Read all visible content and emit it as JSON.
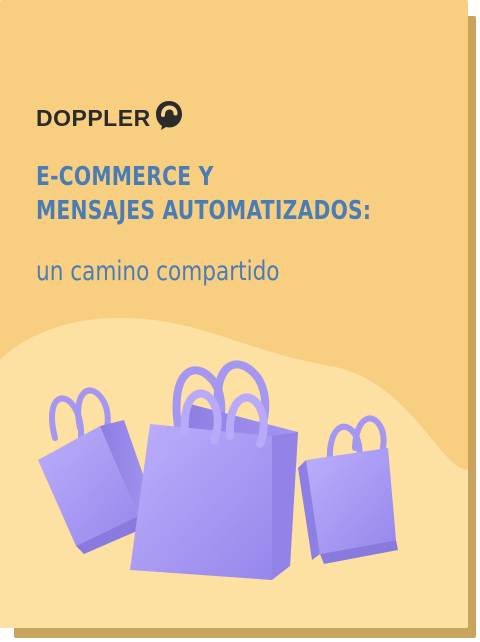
{
  "brand": {
    "name": "DOPPLER"
  },
  "cover": {
    "title_line1": "E-COMMERCE Y",
    "title_line2": "MENSAJES AUTOMATIZADOS:",
    "subtitle": "un camino compartido"
  },
  "colors": {
    "background": "#fad58a",
    "wave": "#fde3a6",
    "title": "#4a7cb5",
    "brand": "#2b2b2b",
    "bag": "#a99af3",
    "page_shadow": "#c8a45c"
  }
}
